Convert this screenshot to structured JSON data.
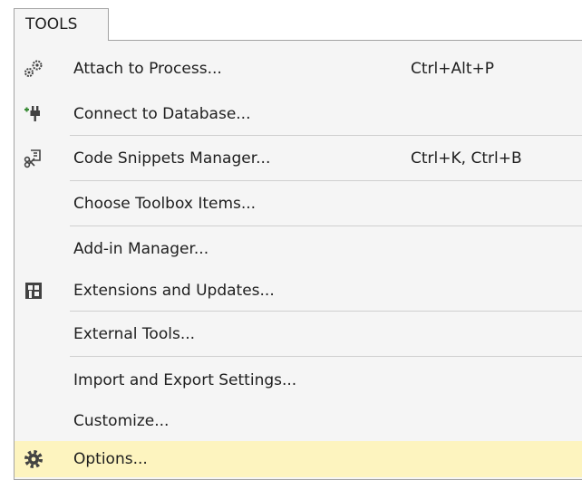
{
  "menu": {
    "title": "TOOLS",
    "items": [
      {
        "label": "Attach to Process...",
        "shortcut": "Ctrl+Alt+P",
        "icon": "attach-process-icon"
      },
      {
        "label": "Connect to Database...",
        "shortcut": "",
        "icon": "connect-database-icon"
      },
      {
        "label": "Code Snippets Manager...",
        "shortcut": "Ctrl+K, Ctrl+B",
        "icon": "code-snippets-icon"
      },
      {
        "label": "Choose Toolbox Items...",
        "shortcut": "",
        "icon": ""
      },
      {
        "label": "Add-in Manager...",
        "shortcut": "",
        "icon": ""
      },
      {
        "label": "Extensions and Updates...",
        "shortcut": "",
        "icon": "extensions-icon"
      },
      {
        "label": "External Tools...",
        "shortcut": "",
        "icon": ""
      },
      {
        "label": "Import and Export Settings...",
        "shortcut": "",
        "icon": ""
      },
      {
        "label": "Customize...",
        "shortcut": "",
        "icon": ""
      },
      {
        "label": "Options...",
        "shortcut": "",
        "icon": "gear-icon",
        "highlighted": true
      }
    ]
  },
  "colors": {
    "menu_background": "#f5f5f5",
    "highlight": "#fdf4bf",
    "border": "#a3a3a3",
    "separator": "#cfcfcf",
    "text": "#1e1e1e"
  }
}
